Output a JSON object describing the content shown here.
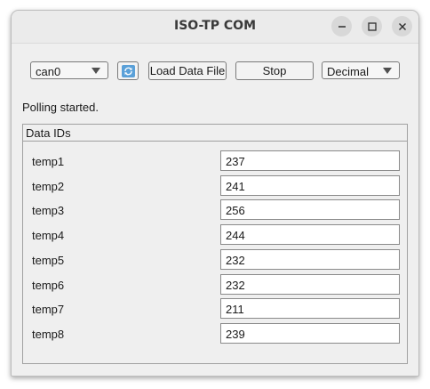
{
  "window": {
    "title": "ISO-TP COM",
    "controls": [
      "minimize-icon",
      "maximize-icon",
      "close-icon"
    ]
  },
  "toolbar": {
    "interface_select": "can0",
    "refresh_icon": "refresh-icon",
    "load_label": "Load Data File",
    "stop_label": "Stop",
    "format_select": "Decimal"
  },
  "status": "Polling started.",
  "data_ids": {
    "title": "Data IDs",
    "rows": [
      {
        "label": "temp1",
        "value": "237"
      },
      {
        "label": "temp2",
        "value": "241"
      },
      {
        "label": "temp3",
        "value": "256"
      },
      {
        "label": "temp4",
        "value": "244"
      },
      {
        "label": "temp5",
        "value": "232"
      },
      {
        "label": "temp6",
        "value": "232"
      },
      {
        "label": "temp7",
        "value": "211"
      },
      {
        "label": "temp8",
        "value": "239"
      }
    ]
  },
  "colors": {
    "window_bg": "#efefef",
    "titlebar_bg": "#ebebeb",
    "field_bg": "#ffffff",
    "border": "#7a7a7a"
  }
}
